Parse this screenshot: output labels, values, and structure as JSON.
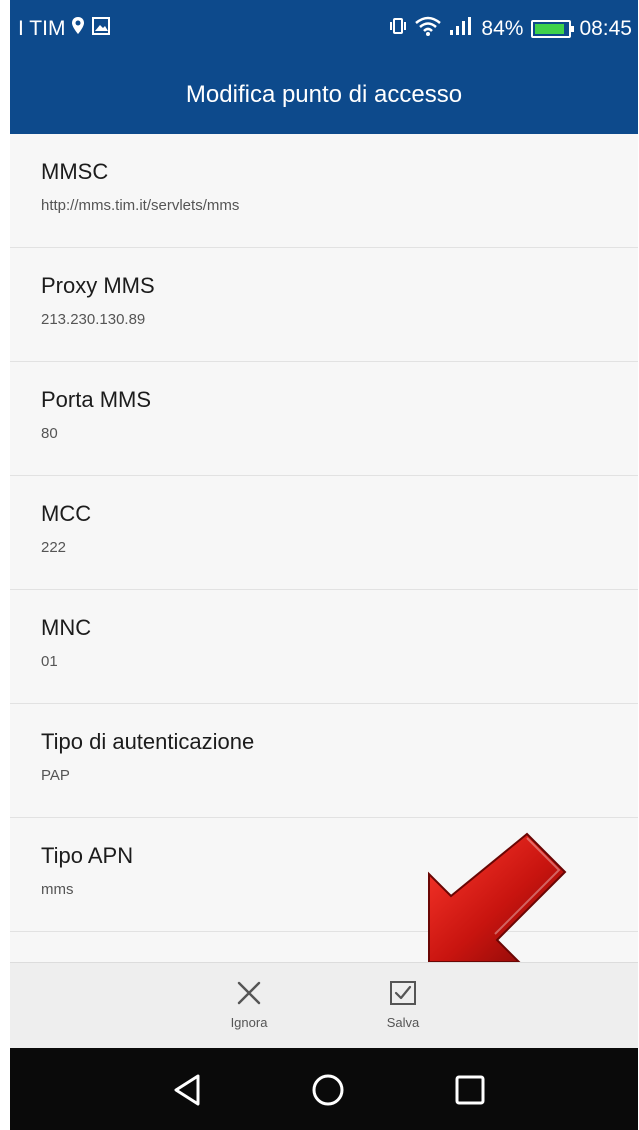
{
  "status_bar": {
    "carrier": "I TIM",
    "battery_percent": "84%",
    "time": "08:45",
    "icons": [
      "location-icon",
      "image-icon",
      "vibrate-icon",
      "wifi-icon",
      "signal-icon",
      "battery-icon"
    ]
  },
  "header": {
    "title": "Modifica punto di accesso"
  },
  "settings": [
    {
      "label": "MMSC",
      "value": "http://mms.tim.it/servlets/mms"
    },
    {
      "label": "Proxy MMS",
      "value": "213.230.130.89"
    },
    {
      "label": "Porta MMS",
      "value": "80"
    },
    {
      "label": "MCC",
      "value": "222"
    },
    {
      "label": "MNC",
      "value": "01"
    },
    {
      "label": "Tipo di autenticazione",
      "value": "PAP"
    },
    {
      "label": "Tipo APN",
      "value": "mms"
    }
  ],
  "actions": {
    "ignore_label": "Ignora",
    "save_label": "Salva"
  },
  "colors": {
    "header_bg": "#0d4a8c",
    "arrow": "#c8140f",
    "navbar_bg": "#0a0a0a"
  },
  "nav_icons": [
    "back-icon",
    "home-icon",
    "recents-icon"
  ]
}
